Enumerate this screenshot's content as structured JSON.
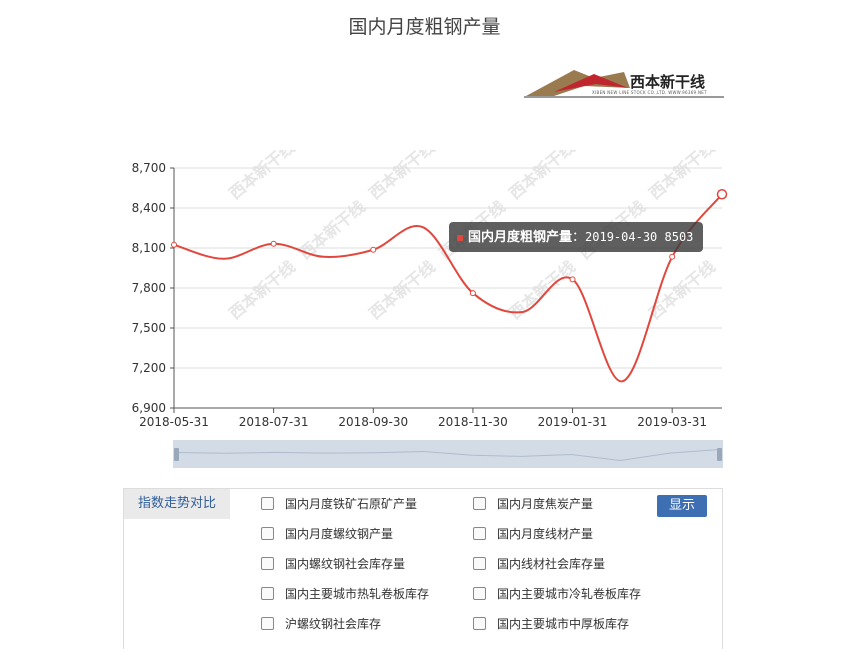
{
  "page": {
    "title": "国内月度粗钢产量"
  },
  "logo": {
    "name": "西本新干线",
    "subtitle": "XIBEN NEW LINE STOCK CO.,LTD.  WWW.96369.NET"
  },
  "colors": {
    "line": "#e1473d",
    "tooltip_bg": "#3c3c3c",
    "button": "#3f6fb3",
    "tab_text": "#2f5d9a"
  },
  "chart_data": {
    "type": "line",
    "series": [
      {
        "name": "国内月度粗钢产量",
        "color": "#e1473d",
        "points": [
          {
            "x": "2018-05-31",
            "y": 8124
          },
          {
            "x": "2018-06-30",
            "y": 8019
          },
          {
            "x": "2018-07-31",
            "y": 8132
          },
          {
            "x": "2018-08-31",
            "y": 8034
          },
          {
            "x": "2018-09-30",
            "y": 8087
          },
          {
            "x": "2018-10-31",
            "y": 8255
          },
          {
            "x": "2018-11-30",
            "y": 7762
          },
          {
            "x": "2018-12-31",
            "y": 7620
          },
          {
            "x": "2019-01-31",
            "y": 7865
          },
          {
            "x": "2019-02-28",
            "y": 7100
          },
          {
            "x": "2019-03-31",
            "y": 8034
          },
          {
            "x": "2019-04-30",
            "y": 8503
          }
        ]
      }
    ],
    "x_ticks": [
      "2018-05-31",
      "2018-07-31",
      "2018-09-30",
      "2018-11-30",
      "2019-01-31",
      "2019-03-31"
    ],
    "y_ticks": [
      "6,900",
      "7,200",
      "7,500",
      "7,800",
      "8,100",
      "8,400",
      "8,700"
    ],
    "ylim": [
      6900,
      8700
    ],
    "grid": true,
    "watermark": "西本新干线"
  },
  "tooltip": {
    "series_name": "国内月度粗钢产量",
    "separator": "：",
    "value_text": "2019-04-30 8503"
  },
  "compare": {
    "tab_label": "指数走势对比",
    "show_button": "显示",
    "items": [
      "国内月度铁矿石原矿产量",
      "国内月度焦炭产量",
      "国内月度螺纹钢产量",
      "国内月度线材产量",
      "国内螺纹钢社会库存量",
      "国内线材社会库存量",
      "国内主要城市热轧卷板库存",
      "国内主要城市冷轧卷板库存",
      "沪螺纹钢社会库存",
      "国内主要城市中厚板库存"
    ]
  }
}
